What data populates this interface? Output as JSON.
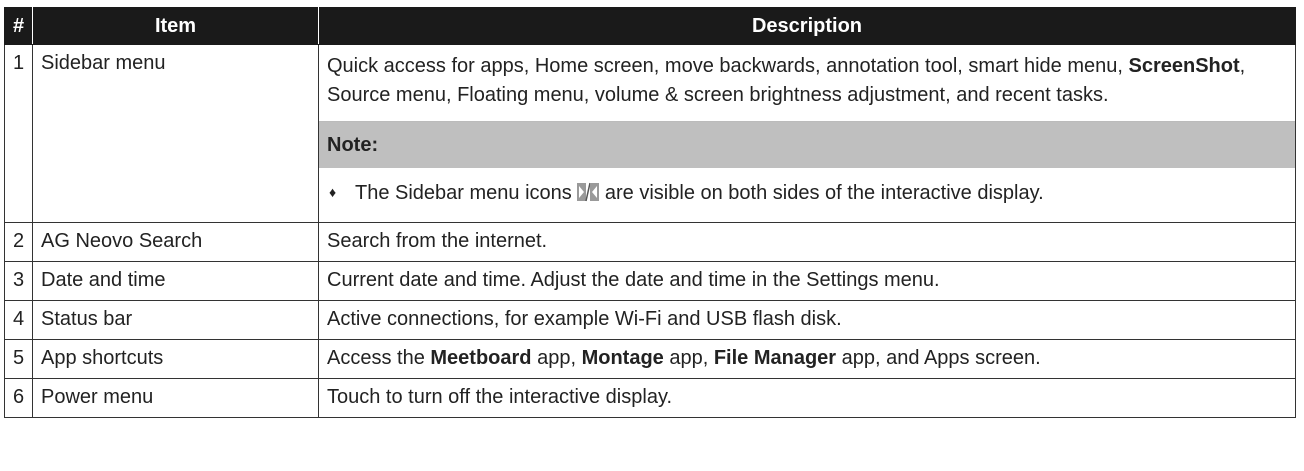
{
  "header": {
    "num": "#",
    "item": "Item",
    "description": "Description"
  },
  "rows": [
    {
      "num": "1",
      "item": "Sidebar menu",
      "desc_parts": [
        "Quick access for apps, Home screen, move backwards, annotation tool, smart hide menu, ",
        "ScreenShot",
        ", Source menu, Floating menu, volume & screen brightness adjustment, and recent tasks."
      ],
      "note_label": "Note:",
      "note_bullet": "♦",
      "note_parts": [
        "The Sidebar menu icons ",
        " are visible on both sides of the interactive display."
      ],
      "note_icon": "sidebar-arrows-icon"
    },
    {
      "num": "2",
      "item": "AG Neovo Search",
      "desc": "Search from the internet."
    },
    {
      "num": "3",
      "item": "Date and time",
      "desc": "Current date and time. Adjust the date and time in the Settings menu."
    },
    {
      "num": "4",
      "item": "Status bar",
      "desc": "Active connections, for example Wi-Fi and USB flash disk."
    },
    {
      "num": "5",
      "item": "App shortcuts",
      "desc_parts": [
        "Access the ",
        "Meetboard",
        " app, ",
        "Montage",
        " app, ",
        "File Manager",
        " app, and Apps screen."
      ]
    },
    {
      "num": "6",
      "item": "Power menu",
      "desc": "Touch to turn off the interactive display."
    }
  ]
}
